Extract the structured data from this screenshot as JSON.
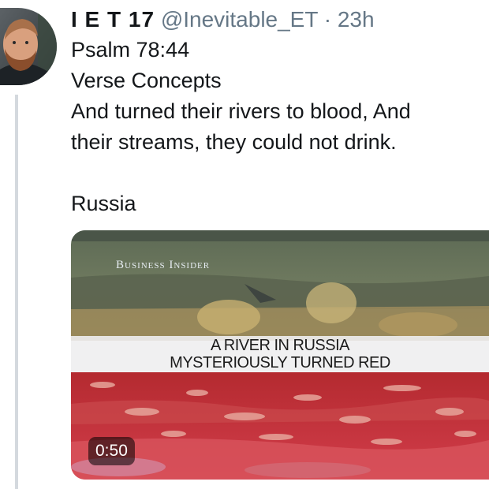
{
  "tweet": {
    "name": "I E T 17",
    "handle": "@Inevitable_ET",
    "separator": "·",
    "time": "23h",
    "lines": [
      "Psalm 78:44",
      "Verse Concepts",
      "And turned their rivers to blood, And",
      "their streams, they could not drink."
    ],
    "extra": "Russia"
  },
  "video": {
    "brand": "Business Insider",
    "headline_line1": "A RIVER IN RUSSIA",
    "headline_line2": "MYSTERIOUSLY TURNED RED",
    "duration": "0:50"
  },
  "icons": {
    "avatar": "profile-photo",
    "media": "video-thumbnail"
  }
}
